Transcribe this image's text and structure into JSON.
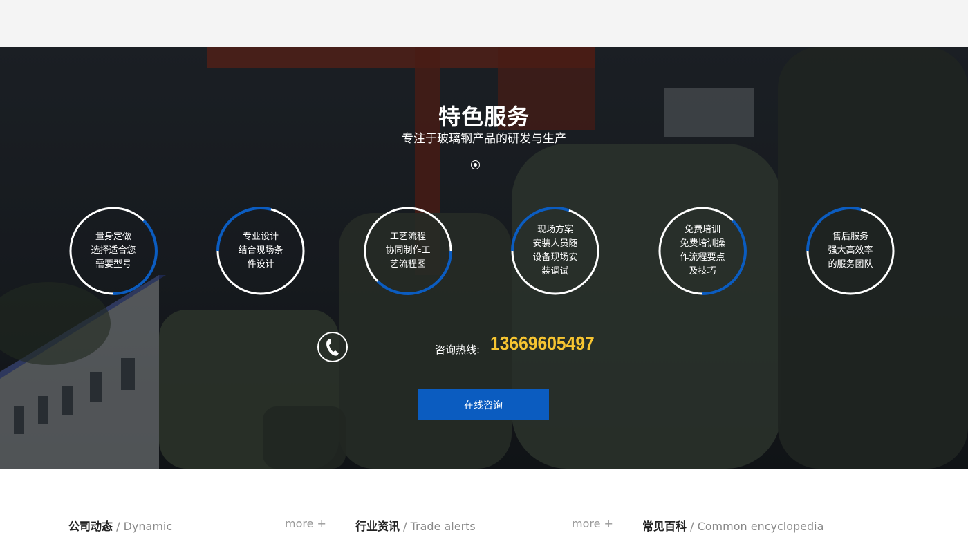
{
  "hero": {
    "title": "特色服务",
    "subtitle": "专注于玻璃钢产品的研发与生产"
  },
  "services": [
    {
      "text": "量身定做\n选择适合您\n需要型号"
    },
    {
      "text": "专业设计\n结合现场条\n件设计"
    },
    {
      "text": "工艺流程\n协同制作工\n艺流程图"
    },
    {
      "text": "现场方案\n安装人员随\n设备现场安\n装调试"
    },
    {
      "text": "免费培训\n免费培训操\n作流程要点\n及技巧"
    },
    {
      "text": "售后服务\n强大高效率\n的服务团队"
    }
  ],
  "hotline": {
    "label": "咨询热线:",
    "number": "13669605497"
  },
  "consult_button": "在线咨询",
  "news": [
    {
      "title": "公司动态",
      "en": " / Dynamic",
      "more": "more +"
    },
    {
      "title": "行业资讯",
      "en": " / Trade alerts",
      "more": "more +"
    },
    {
      "title": "常见百科",
      "en": " / Common encyclopedia"
    }
  ],
  "colors": {
    "accent_blue": "#0b5cc0",
    "hotline_yellow": "#f7c531",
    "hero_dark": "#1e2227"
  }
}
